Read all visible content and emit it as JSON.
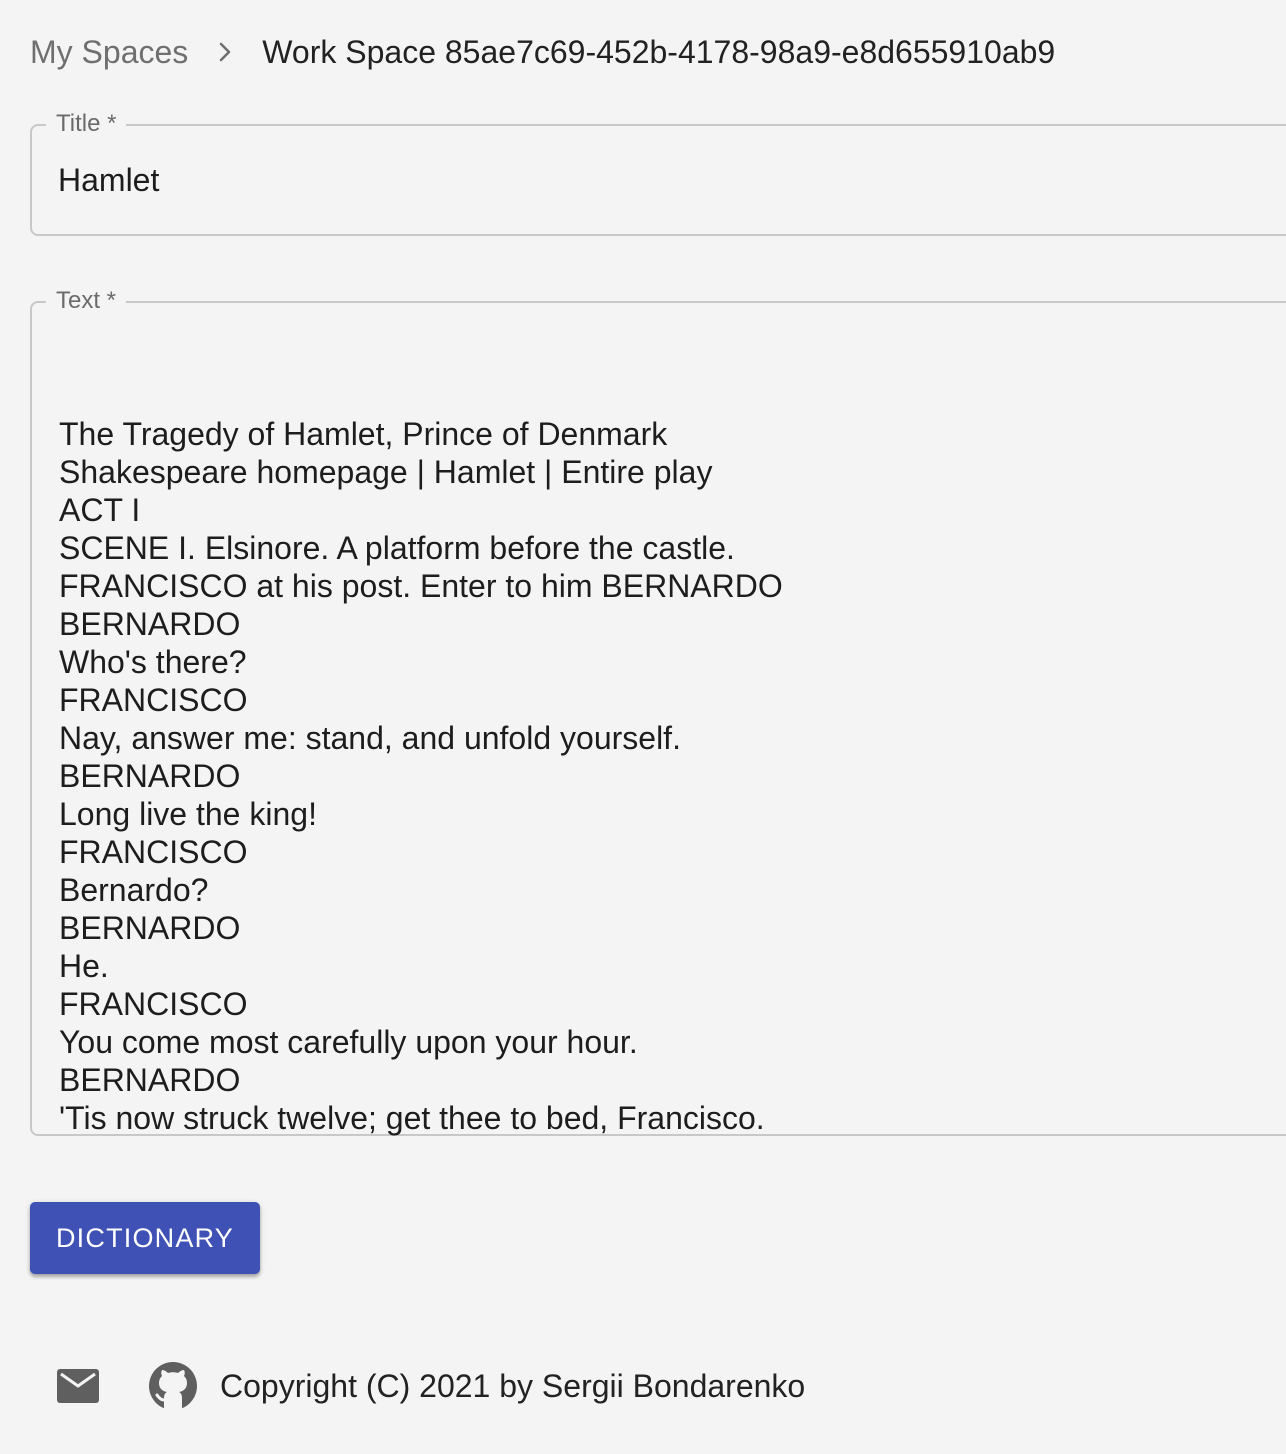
{
  "breadcrumb": {
    "root_label": "My Spaces",
    "current_label": "Work Space 85ae7c69-452b-4178-98a9-e8d655910ab9",
    "separator_icon": "chevron-right-icon"
  },
  "title_field": {
    "label": "Title *",
    "value": "Hamlet"
  },
  "text_field": {
    "label": "Text *",
    "lines": [
      "",
      "The Tragedy of Hamlet, Prince of Denmark",
      "Shakespeare homepage | Hamlet | Entire play",
      "ACT I",
      "SCENE I. Elsinore. A platform before the castle.",
      "FRANCISCO at his post. Enter to him BERNARDO",
      "BERNARDO",
      "Who's there?",
      "FRANCISCO",
      "Nay, answer me: stand, and unfold yourself.",
      "BERNARDO",
      "Long live the king!",
      "FRANCISCO",
      "Bernardo?",
      "BERNARDO",
      "He.",
      "FRANCISCO",
      "You come most carefully upon your hour.",
      "BERNARDO",
      "'Tis now struck twelve; get thee to bed, Francisco."
    ]
  },
  "actions": {
    "dictionary_label": "DICTIONARY"
  },
  "footer": {
    "mail_icon": "mail-icon",
    "github_icon": "github-icon",
    "copyright": "Copyright (C) 2021 by Sergii Bondarenko"
  },
  "colors": {
    "primary": "#3f51b5",
    "background": "#f4f4f4",
    "border": "#c8c8c8",
    "muted_text": "#6f6f6f"
  }
}
